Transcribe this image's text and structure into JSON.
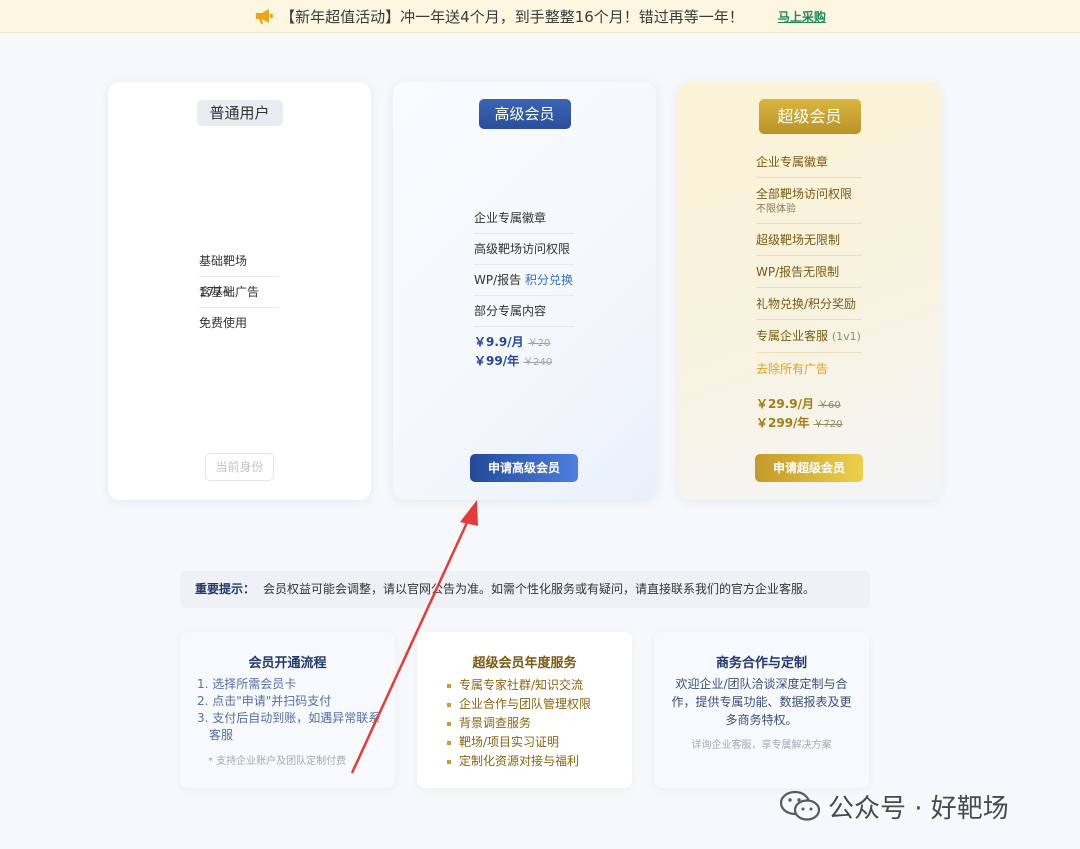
{
  "banner": {
    "text": "【新年超值活动】冲一年送4个月，到手整整16个月！错过再等一年！",
    "cta": "马上采购",
    "icon": "megaphone-icon",
    "accent_color": "#f0a21a"
  },
  "plans": {
    "basic": {
      "title": "普通用户",
      "features": [
        "基础靶场 177+",
        "含基础广告",
        "免费使用"
      ],
      "button": "当前身份"
    },
    "advanced": {
      "title": "高级会员",
      "features": [
        "企业专属徽章",
        "高级靶场访问权限",
        "部分专属内容"
      ],
      "feature_wp_prefix": "WP/报告",
      "feature_wp_accent": "积分兑换",
      "price_month": "￥9.9/月",
      "price_month_original": "￥20",
      "price_year": "￥99/年",
      "price_year_original": "￥240",
      "button": "申请高级会员",
      "color": "#2a4f9b"
    },
    "super": {
      "title": "超级会员",
      "features": {
        "badge": "企业专属徽章",
        "all_access": "全部靶场访问权限",
        "all_access_sub": "不限体验",
        "unlimited_range": "超级靶场无限制",
        "wp_unlimited": "WP/报告无限制",
        "gift": "礼物兑换/积分奖励",
        "service": "专属企业客服",
        "service_tag": "(1v1)",
        "no_ads": "去除所有广告"
      },
      "price_month": "￥29.9/月",
      "price_month_original": "￥60",
      "price_year": "￥299/年",
      "price_year_original": "￥720",
      "button": "申请超级会员",
      "color": "#c49a2a"
    }
  },
  "notice": {
    "label": "重要提示：",
    "text": "会员权益可能会调整，请以官网公告为准。如需个性化服务或有疑问，请直接联系我们的官方企业客服。"
  },
  "flow": {
    "title": "会员开通流程",
    "steps": [
      "1. 选择所需会员卡",
      "2. 点击\"申请\"并扫码支付",
      "3. 支付后自动到账，如遇异常联系客服"
    ],
    "note": "* 支持企业账户及团队定制付费"
  },
  "super_service": {
    "title": "超级会员年度服务",
    "items": [
      "专属专家社群/知识交流",
      "企业合作与团队管理权限",
      "背景调查服务",
      "靶场/项目实习证明",
      "定制化资源对接与福利"
    ]
  },
  "biz": {
    "title": "商务合作与定制",
    "text": "欢迎企业/团队洽谈深度定制与合作，提供专属功能、数据报表及更多商务特权。",
    "note": "详询企业客服，享专属解决方案"
  },
  "watermark": {
    "text": "公众号 · 好靶场",
    "icon": "wechat-icon"
  }
}
